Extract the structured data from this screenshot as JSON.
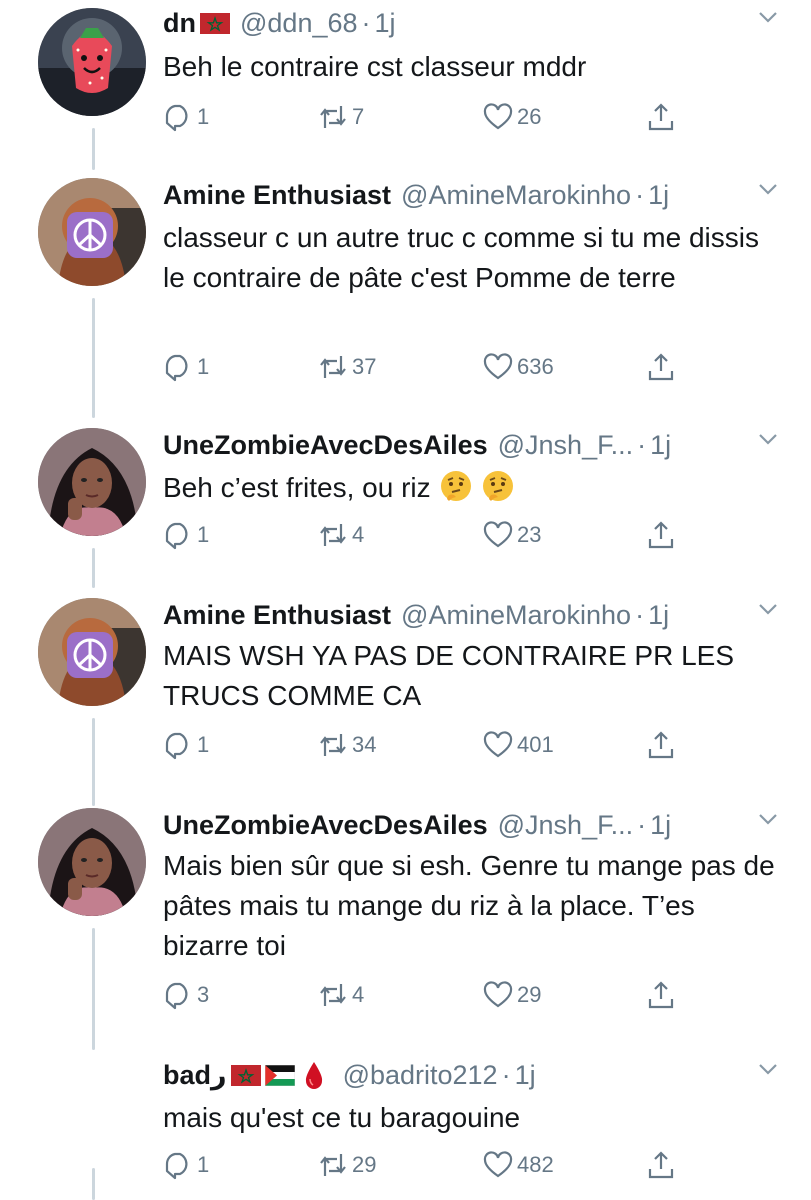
{
  "colors": {
    "text": "#14171a",
    "secondary": "#657786",
    "thread_line": "#ccd6dd",
    "background": "#ffffff"
  },
  "tweets": [
    {
      "name": "dn",
      "name_icons": [
        "morocco-flag-icon"
      ],
      "handle": "@ddn_68",
      "dot": "·",
      "time": "1j",
      "text": "Beh le contraire cst classeur mddr",
      "replies": "1",
      "retweets": "7",
      "likes": "26"
    },
    {
      "name": "Amine Enthusiast",
      "handle": "@AmineMarokinho",
      "dot": "·",
      "time": "1j",
      "text": "classeur c un autre truc c comme si tu me dissis le contraire de pâte c'est Pomme de terre",
      "replies": "1",
      "retweets": "37",
      "likes": "636"
    },
    {
      "name": "UneZombieAvecDesAiles",
      "handle": "@Jnsh_F...",
      "dot": "·",
      "time": "1j",
      "text": "Beh c’est frites, ou riz",
      "text_icons": [
        "thinking-face-icon",
        "thinking-face-icon"
      ],
      "replies": "1",
      "retweets": "4",
      "likes": "23"
    },
    {
      "name": "Amine Enthusiast",
      "handle": "@AmineMarokinho",
      "dot": "·",
      "time": "1j",
      "text": "MAIS WSH YA PAS DE CONTRAIRE PR LES TRUCS COMME CA",
      "replies": "1",
      "retweets": "34",
      "likes": "401"
    },
    {
      "name": "UneZombieAvecDesAiles",
      "handle": "@Jnsh_F...",
      "dot": "·",
      "time": "1j",
      "text": "Mais bien sûr que si esh. Genre tu mange pas de pâtes mais tu mange du riz à la place. T’es bizarre toi",
      "replies": "3",
      "retweets": "4",
      "likes": "29"
    },
    {
      "name": "badر",
      "name_icons": [
        "morocco-flag-icon",
        "palestine-flag-icon",
        "drop-of-blood-icon"
      ],
      "handle": "@badrito212",
      "dot": "·",
      "time": "1j",
      "text": "mais qu'est ce tu baragouine",
      "replies": "1",
      "retweets": "29",
      "likes": "482"
    }
  ]
}
